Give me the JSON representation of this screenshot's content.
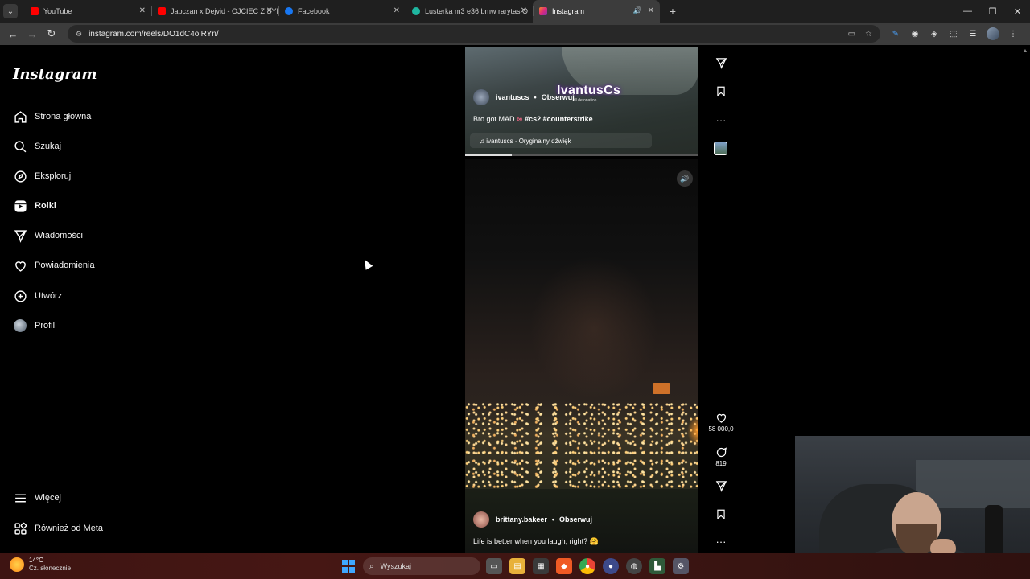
{
  "browser": {
    "tabs": [
      {
        "title": "YouTube",
        "favicon_color": "#ff0000"
      },
      {
        "title": "Japczan x Dejvid - OJCIEC Z SYN",
        "favicon_color": "#ff0000"
      },
      {
        "title": "Facebook",
        "favicon_color": "#1877f2"
      },
      {
        "title": "Lusterka m3 e36 bmw rarytas O",
        "favicon_color": "#1fb6a0"
      },
      {
        "title": "Instagram",
        "favicon_color": "#e1306c"
      }
    ],
    "url": "instagram.com/reels/DO1dC4oiRYn/"
  },
  "sidebar": {
    "logo": "Instagram",
    "items": [
      {
        "label": "Strona główna",
        "icon": "home-icon"
      },
      {
        "label": "Szukaj",
        "icon": "search-icon"
      },
      {
        "label": "Eksploruj",
        "icon": "compass-icon"
      },
      {
        "label": "Rolki",
        "icon": "reels-icon"
      },
      {
        "label": "Wiadomości",
        "icon": "send-icon"
      },
      {
        "label": "Powiadomienia",
        "icon": "heart-icon"
      },
      {
        "label": "Utwórz",
        "icon": "plus-square-icon"
      },
      {
        "label": "Profil",
        "icon": "avatar"
      }
    ],
    "more": "Więcej",
    "meta": "Również od Meta"
  },
  "reel_top": {
    "username": "ivantuscs",
    "follow": "Obserwuj",
    "watermark": "IvantusCs",
    "watermark_sub": "till detonation",
    "caption_prefix": "Bro got MAD",
    "hashtags": "#cs2 #counterstrike",
    "audio": "ivantuscs · Oryginalny dźwięk"
  },
  "reel_main": {
    "username": "brittany.bakeer",
    "follow": "Obserwuj",
    "caption": "Life is better when you laugh, right? 🤗"
  },
  "actions": {
    "likes": "58 000,0",
    "comments": "819"
  },
  "taskbar": {
    "temp": "14°C",
    "weather": "Cz. słonecznie",
    "search_placeholder": "Wyszukaj"
  },
  "colors": {
    "accent": "#ffffff",
    "background": "#000000",
    "taskbar": "#461714"
  }
}
